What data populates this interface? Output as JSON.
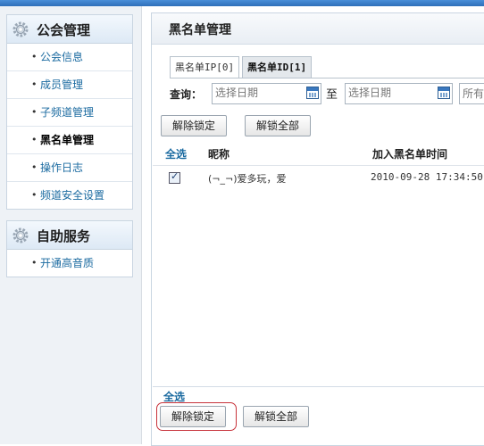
{
  "sidebar": {
    "guild": {
      "title": "公会管理",
      "items": [
        {
          "label": "公会信息"
        },
        {
          "label": "成员管理"
        },
        {
          "label": "子频道管理"
        },
        {
          "label": "黑名单管理"
        },
        {
          "label": "操作日志"
        },
        {
          "label": "频道安全设置"
        }
      ],
      "active_index": 3
    },
    "self_service": {
      "title": "自助服务",
      "items": [
        {
          "label": "开通高音质"
        }
      ]
    },
    "bullet": "•"
  },
  "main": {
    "title": "黑名单管理",
    "tabs": [
      {
        "label": "黑名单IP[0]",
        "active": false
      },
      {
        "label": "黑名单ID[1]",
        "active": true
      }
    ],
    "query": {
      "label": "查询：",
      "start_placeholder": "选择日期",
      "to_label": "至",
      "end_placeholder": "选择日期",
      "select_value": "所有"
    },
    "top_buttons": {
      "unlock": "解除锁定",
      "unlock_all": "解锁全部"
    },
    "table": {
      "headers": {
        "select_all": "全选",
        "nickname": "昵称",
        "time": "加入黑名单时间"
      },
      "rows": [
        {
          "checked": true,
          "nickname": "(¬_¬)爱多玩，爱",
          "time": "2010-09-28 17:34:50"
        }
      ]
    },
    "footer": {
      "select_all": "全选",
      "unlock": "解除锁定",
      "unlock_all": "解锁全部"
    }
  },
  "colors": {
    "topbar": "#3a7cc8",
    "link": "#1a6aa0",
    "highlight": "#c7323a"
  }
}
